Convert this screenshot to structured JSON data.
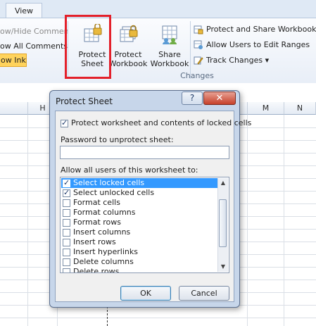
{
  "ribbon": {
    "tab_view": "View",
    "left_items": [
      "ow/Hide Commen",
      "ow All Comments",
      "ow Ink"
    ],
    "protect_sheet": [
      "Protect",
      "Sheet"
    ],
    "protect_workbook": [
      "Protect",
      "Workbook"
    ],
    "share_workbook": [
      "Share",
      "Workbook"
    ],
    "protect_share": "Protect and Share Workbook",
    "allow_users": "Allow Users to Edit Ranges",
    "track_changes": "Track Changes ▾",
    "group_label": "Changes"
  },
  "sheet": {
    "columns": [
      "H",
      "M",
      "N"
    ]
  },
  "dialog": {
    "title": "Protect Sheet",
    "help": "?",
    "close": "✕",
    "protect_label": "Protect worksheet and contents of locked cells",
    "protect_checked": true,
    "password_label": "Password to unprotect sheet:",
    "password_value": "",
    "allow_label": "Allow all users of this worksheet to:",
    "permissions": [
      {
        "label": "Select locked cells",
        "checked": true
      },
      {
        "label": "Select unlocked cells",
        "checked": true
      },
      {
        "label": "Format cells",
        "checked": false
      },
      {
        "label": "Format columns",
        "checked": false
      },
      {
        "label": "Format rows",
        "checked": false
      },
      {
        "label": "Insert columns",
        "checked": false
      },
      {
        "label": "Insert rows",
        "checked": false
      },
      {
        "label": "Insert hyperlinks",
        "checked": false
      },
      {
        "label": "Delete columns",
        "checked": false
      },
      {
        "label": "Delete rows",
        "checked": false
      }
    ],
    "ok": "OK",
    "cancel": "Cancel"
  }
}
